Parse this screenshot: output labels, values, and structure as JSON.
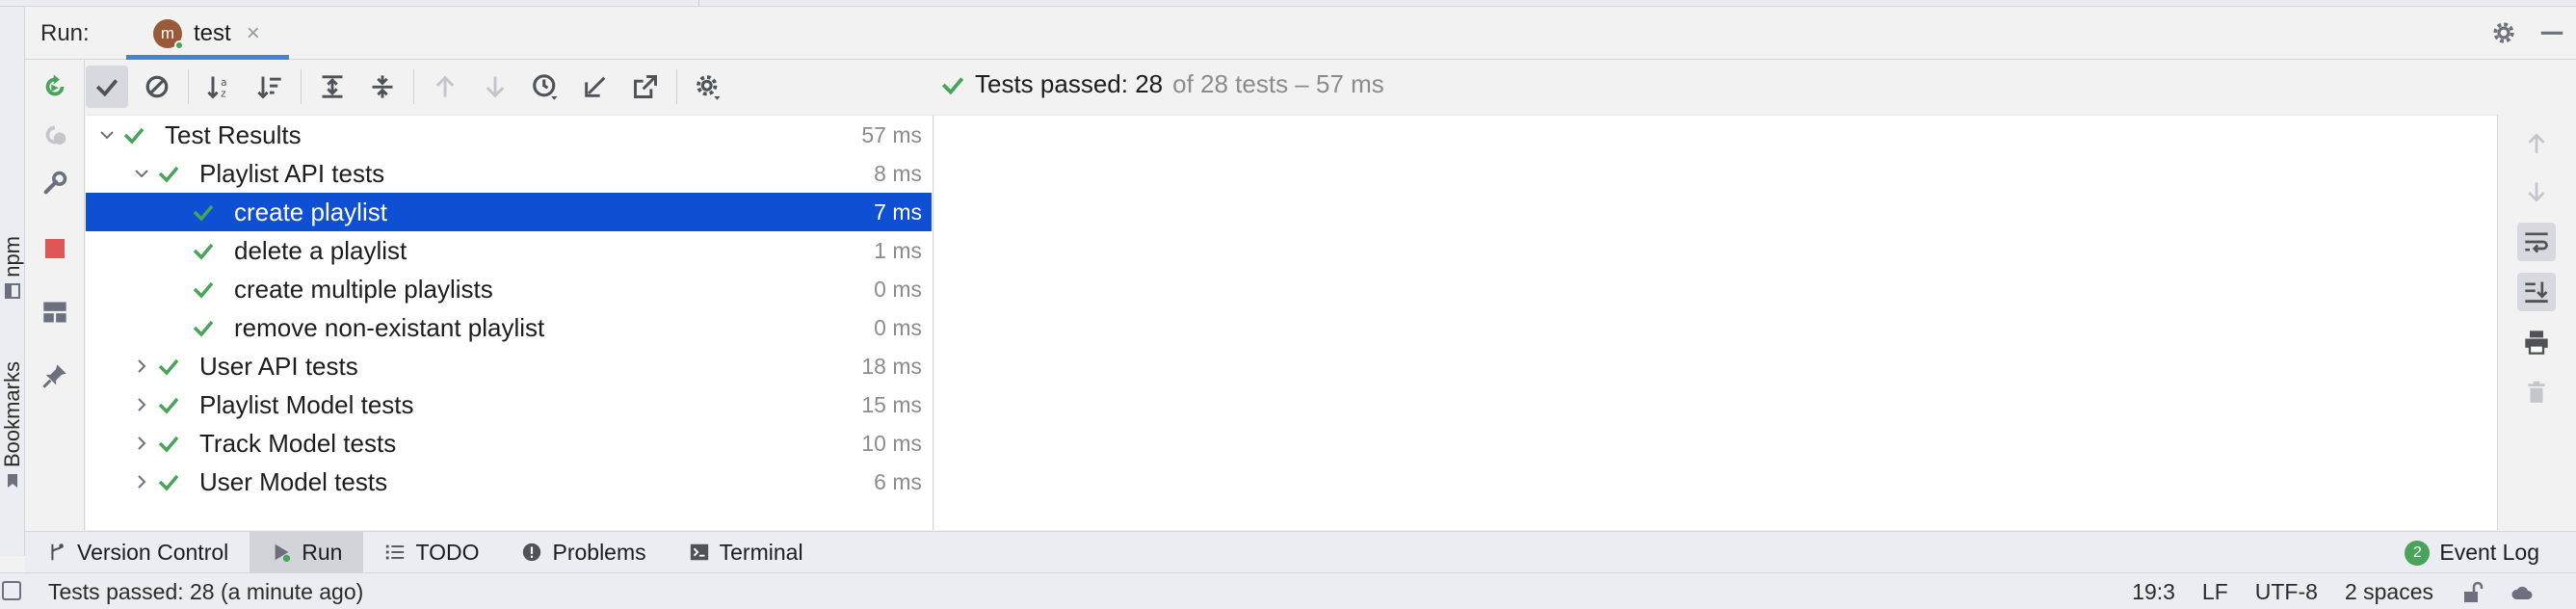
{
  "run_header": {
    "label": "Run:",
    "tab_title": "test",
    "tab_icon_letter": "m",
    "tab_close": "×"
  },
  "left_strip": {
    "tabs": [
      "npm",
      "Bookmarks"
    ]
  },
  "summary": {
    "passed_text": "Tests passed: 28",
    "rest_text": "of 28 tests – 57 ms"
  },
  "tree": {
    "rows": [
      {
        "label": "Test Results",
        "duration": "57 ms",
        "level": 0,
        "expanded": true
      },
      {
        "label": "Playlist API tests",
        "duration": "8 ms",
        "level": 1,
        "expanded": true
      },
      {
        "label": "create playlist",
        "duration": "7 ms",
        "level": 2,
        "selected": true
      },
      {
        "label": "delete a playlist",
        "duration": "1 ms",
        "level": 2
      },
      {
        "label": "create multiple playlists",
        "duration": "0 ms",
        "level": 2
      },
      {
        "label": "remove non-existant playlist",
        "duration": "0 ms",
        "level": 2
      },
      {
        "label": "User API tests",
        "duration": "18 ms",
        "level": 1,
        "expanded": false
      },
      {
        "label": "Playlist Model tests",
        "duration": "15 ms",
        "level": 1,
        "expanded": false
      },
      {
        "label": "Track Model tests",
        "duration": "10 ms",
        "level": 1,
        "expanded": false
      },
      {
        "label": "User Model tests",
        "duration": "6 ms",
        "level": 1,
        "expanded": false
      }
    ]
  },
  "bottom_tabs": [
    {
      "label": "Version Control",
      "icon": "branch-icon"
    },
    {
      "label": "Run",
      "icon": "run-icon",
      "active": true
    },
    {
      "label": "TODO",
      "icon": "list-icon"
    },
    {
      "label": "Problems",
      "icon": "problems-icon"
    },
    {
      "label": "Terminal",
      "icon": "terminal-icon"
    }
  ],
  "event_log": {
    "label": "Event Log",
    "count": "2"
  },
  "status_bar": {
    "message": "Tests passed: 28 (a minute ago)",
    "position": "19:3",
    "line_sep": "LF",
    "encoding": "UTF-8",
    "indent": "2 spaces"
  },
  "colors": {
    "accent": "#3f86ce",
    "selection": "#0f4fd3",
    "pass_green": "#4aa35a",
    "stop_red": "#e05555"
  }
}
